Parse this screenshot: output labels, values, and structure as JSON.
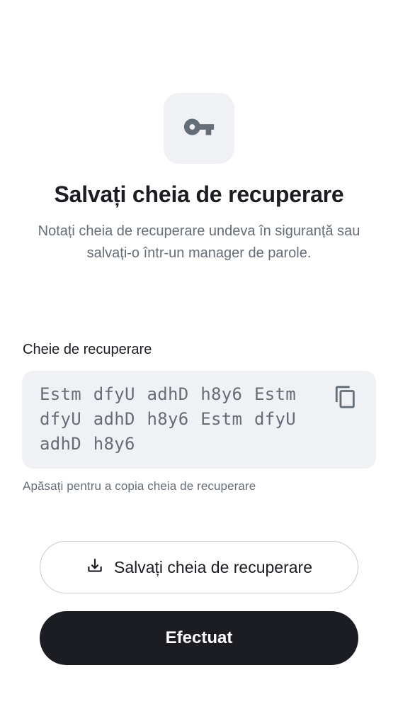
{
  "header": {
    "icon": "key-icon",
    "title": "Salvați cheia de recuperare",
    "subtitle": "Notați cheia de recuperare undeva în siguranță sau salvați-o într-un manager de parole."
  },
  "recovery_key": {
    "label": "Cheie de recuperare",
    "value": "Estm dfyU adhD h8y6 Estm dfyU adhD h8y6 Estm dfyU adhD h8y6",
    "copy_icon": "copy-icon",
    "helper": "Apăsați pentru a copia cheia de recuperare"
  },
  "actions": {
    "save_icon": "download-icon",
    "save_label": "Salvați cheia de recuperare",
    "done_label": "Efectuat"
  },
  "colors": {
    "background": "#ffffff",
    "surface": "#eff1f4",
    "primary": "#1b1d22",
    "secondary_text": "#656d77",
    "outline": "#c8cbd0"
  }
}
